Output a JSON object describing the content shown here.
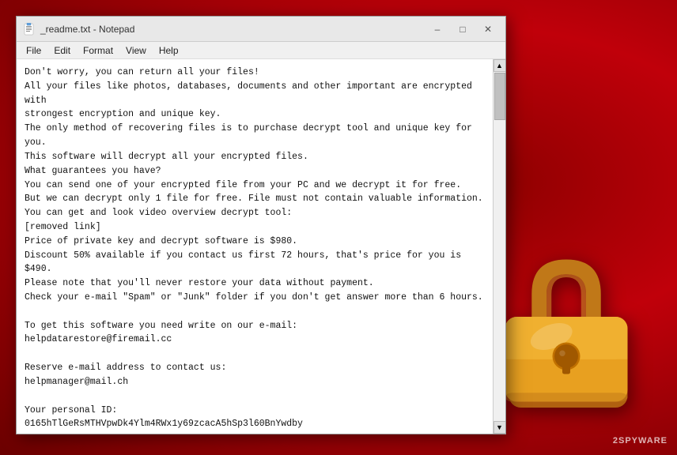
{
  "background": {
    "color": "#c0000a"
  },
  "window": {
    "title": "_readme.txt - Notepad",
    "icon": "notepad-icon"
  },
  "titlebar": {
    "minimize_label": "–",
    "maximize_label": "□",
    "close_label": "✕"
  },
  "menubar": {
    "items": [
      {
        "label": "File"
      },
      {
        "label": "Edit"
      },
      {
        "label": "Format"
      },
      {
        "label": "View"
      },
      {
        "label": "Help"
      }
    ]
  },
  "content": {
    "text": "Don't worry, you can return all your files!\nAll your files like photos, databases, documents and other important are encrypted with\nstrongest encryption and unique key.\nThe only method of recovering files is to purchase decrypt tool and unique key for you.\nThis software will decrypt all your encrypted files.\nWhat guarantees you have?\nYou can send one of your encrypted file from your PC and we decrypt it for free.\nBut we can decrypt only 1 file for free. File must not contain valuable information.\nYou can get and look video overview decrypt tool:\n[removed link]\nPrice of private key and decrypt software is $980.\nDiscount 50% available if you contact us first 72 hours, that's price for you is $490.\nPlease note that you'll never restore your data without payment.\nCheck your e-mail \"Spam\" or \"Junk\" folder if you don't get answer more than 6 hours.\n\nTo get this software you need write on our e-mail:\nhelpdatarestore@firemail.cc\n\nReserve e-mail address to contact us:\nhelpmanager@mail.ch\n\nYour personal ID:\n0165hTlGeRsMTHVpwDk4Ylm4RWx1y69zcacA5hSp3l60BnYwdby"
  },
  "watermark": {
    "text": "2SPYWARE"
  }
}
